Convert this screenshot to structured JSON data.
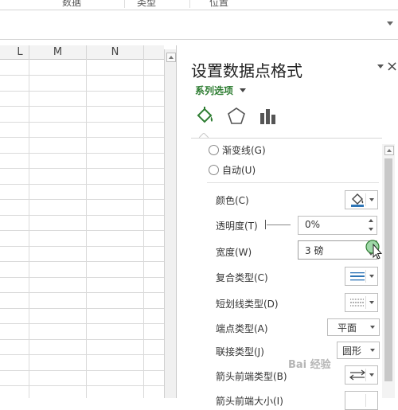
{
  "ribbon": {
    "tabs": [
      "数据",
      "类型",
      "位置"
    ]
  },
  "sheet": {
    "columns": [
      "L",
      "M",
      "N"
    ]
  },
  "pane": {
    "title": "设置数据点格式",
    "close": "×",
    "series_options": "系列选项",
    "tabs": [
      "fill-line-icon",
      "effects-pentagon-icon",
      "series-options-bars-icon"
    ],
    "line_options": [
      {
        "label": "渐变线(G)"
      },
      {
        "label": "自动(U)"
      }
    ],
    "color_label": "颜色(C)",
    "transparency_label": "透明度(T)",
    "transparency_value": "0%",
    "width_label": "宽度(W)",
    "width_value": "3 磅",
    "compound_label": "复合类型(C)",
    "dash_label": "短划线类型(D)",
    "cap_label": "端点类型(A)",
    "cap_value": "平面",
    "join_label": "联接类型(J)",
    "join_value": "圆形",
    "arrow_begin_label": "箭头前端类型(B)",
    "arrow_size_label": "箭头前端大小(I)"
  },
  "watermark": "Bai 经验",
  "colors": {
    "accent_green": "#2e7d32",
    "line_color_swatch": "#2e75b6"
  }
}
